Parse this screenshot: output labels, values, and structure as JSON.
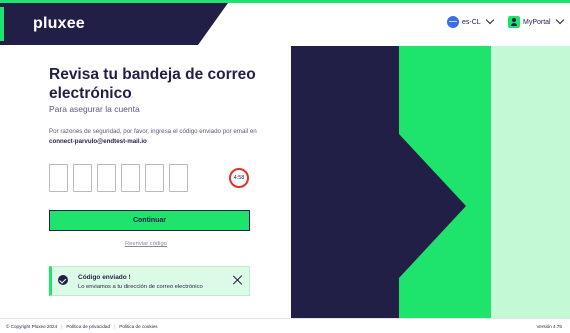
{
  "header": {
    "logo": "pluxee",
    "language": {
      "label": "es-CL",
      "icon": "globe-icon"
    },
    "portal": {
      "label": "MyPortal",
      "icon": "user-icon"
    }
  },
  "form": {
    "title": "Revisa tu bandeja de correo electrónico",
    "subtitle": "Para asegurar la cuenta",
    "description_prefix": "Por razones de seguridad, por favor, ingresa el código enviado por email en ",
    "email": "connect-parvulo@endtest-mail.io",
    "code_digits": [
      "",
      "",
      "",
      "",
      "",
      ""
    ],
    "timer": "4:58",
    "continue_label": "Continuar",
    "resend_label": "Reenviar código"
  },
  "toast": {
    "title": "Código enviado !",
    "message": "Lo enviamos a tu dirección de correo electrónico"
  },
  "footer": {
    "copyright": "© Copyright Pluxee 2024",
    "privacy": "Política de privacidad",
    "cookies": "Política de cookies",
    "version": "Versión 4.75"
  },
  "colors": {
    "brand_navy": "#221f46",
    "brand_green": "#1ee36c",
    "light_green": "#c4f9d6",
    "timer_red": "#e0312b"
  }
}
